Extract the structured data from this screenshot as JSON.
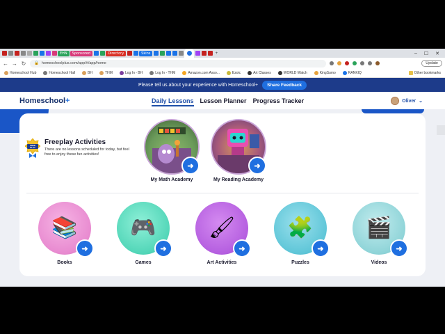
{
  "browser": {
    "tab_pills": [
      {
        "label": "EHN",
        "color": "#2aa35a"
      },
      {
        "label": "Sponsored",
        "color": "#d83a7a"
      },
      {
        "label": "Directory",
        "color": "#d93025"
      },
      {
        "label": "Skins",
        "color": "#1a73e8"
      }
    ],
    "url": "homeschoolplus.com/app/#/app/home",
    "update_label": "Update",
    "bookmarks": [
      "Homeschool Hub",
      "Homeschool Hall",
      "BH",
      "THM",
      "Log In - BH",
      "Log In - THM",
      "Amazon.com Asso...",
      "Ezoic",
      "Art Classes",
      "WORLD Watch",
      "KingSumo",
      "RANKIQ"
    ],
    "other_bookmarks": "Other bookmarks"
  },
  "banner": {
    "text": "Please tell us about your experience with Homeschool+",
    "button": "Share Feedback"
  },
  "nav": {
    "logo": "Homeschool",
    "logo_plus": "+",
    "links": [
      "Daily Lessons",
      "Lesson Planner",
      "Progress Tracker"
    ],
    "profile_name": "Oliver",
    "profile_caret": "⌄"
  },
  "freeplay": {
    "badge": "FREE PLAY",
    "title": "Freeplay Activities",
    "subtitle": "There are no lessons scheduled for today, but feel free to enjoy these fun activities!"
  },
  "academies": [
    {
      "label": "My Math Academy",
      "color": "#6a9a5a"
    },
    {
      "label": "My Reading Academy",
      "color": "#7a4ba8"
    }
  ],
  "activities": [
    {
      "label": "Books",
      "color": "#e88ad0",
      "icon": "📚"
    },
    {
      "label": "Games",
      "color": "#52d6b8",
      "icon": "🎮"
    },
    {
      "label": "Art Activities",
      "color": "#b55fe0",
      "icon": "🖌"
    },
    {
      "label": "Puzzles",
      "color": "#5fc6d8",
      "icon": "🧩"
    },
    {
      "label": "Videos",
      "color": "#8fd4d8",
      "icon": "🎬"
    }
  ],
  "arrow_glyph": "➜"
}
